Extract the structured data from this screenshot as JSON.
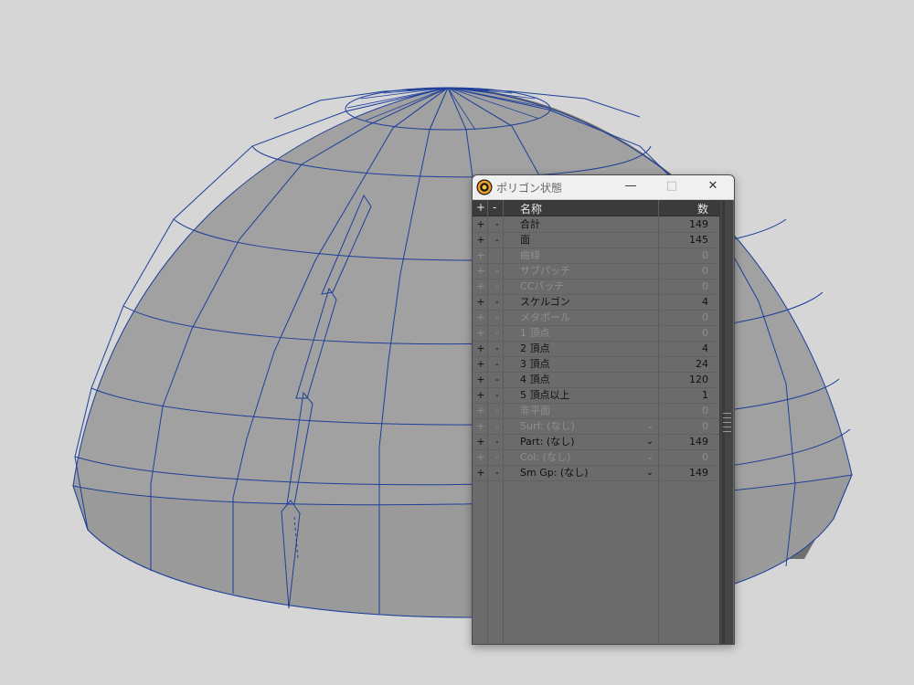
{
  "window": {
    "title": "ポリゴン状態",
    "minimize_glyph": "—",
    "maximize_glyph": "□",
    "close_glyph": "✕",
    "icon": "modo-logo-icon"
  },
  "table": {
    "headers": {
      "plus": "+",
      "minus": "-",
      "name": "名称",
      "count": "数"
    },
    "rows": [
      {
        "plus": "+",
        "minus": "-",
        "name": "合計",
        "count": "149",
        "active": true,
        "dropdown": ""
      },
      {
        "plus": "+",
        "minus": "-",
        "name": "面",
        "count": "145",
        "active": true,
        "dropdown": ""
      },
      {
        "plus": "+",
        "minus": "-",
        "name": "曲線",
        "count": "0",
        "active": false,
        "dropdown": ""
      },
      {
        "plus": "+",
        "minus": "-",
        "name": "サブパッチ",
        "count": "0",
        "active": false,
        "dropdown": ""
      },
      {
        "plus": "+",
        "minus": "-",
        "name": "CCパッチ",
        "count": "0",
        "active": false,
        "dropdown": ""
      },
      {
        "plus": "+",
        "minus": "-",
        "name": "スケルゴン",
        "count": "4",
        "active": true,
        "dropdown": ""
      },
      {
        "plus": "+",
        "minus": "-",
        "name": "メタボール",
        "count": "0",
        "active": false,
        "dropdown": ""
      },
      {
        "plus": "+",
        "minus": "-",
        "name": "1 頂点",
        "count": "0",
        "active": false,
        "dropdown": ""
      },
      {
        "plus": "+",
        "minus": "-",
        "name": "2 頂点",
        "count": "4",
        "active": true,
        "dropdown": ""
      },
      {
        "plus": "+",
        "minus": "-",
        "name": "3 頂点",
        "count": "24",
        "active": true,
        "dropdown": ""
      },
      {
        "plus": "+",
        "minus": "-",
        "name": "4 頂点",
        "count": "120",
        "active": true,
        "dropdown": ""
      },
      {
        "plus": "+",
        "minus": "-",
        "name": "5 頂点以上",
        "count": "1",
        "active": true,
        "dropdown": ""
      },
      {
        "plus": "+",
        "minus": "-",
        "name": "非平面",
        "count": "0",
        "active": false,
        "dropdown": ""
      },
      {
        "plus": "+",
        "minus": "-",
        "name": "Surf: (なし)",
        "count": "0",
        "active": false,
        "dropdown": "⌄"
      },
      {
        "plus": "+",
        "minus": "-",
        "name": "Part: (なし)",
        "count": "149",
        "active": true,
        "dropdown": "⌄"
      },
      {
        "plus": "+",
        "minus": "-",
        "name": "Col: (なし)",
        "count": "0",
        "active": false,
        "dropdown": "⌄"
      },
      {
        "plus": "+",
        "minus": "-",
        "name": "Sm Gp: (なし)",
        "count": "149",
        "active": true,
        "dropdown": "⌄"
      }
    ]
  },
  "colors": {
    "background": "#d6d6d6",
    "mesh_fill": "#999999",
    "mesh_wire": "#1f3f9a",
    "panel_bg": "#6b6b6b",
    "header_bg": "#3b3b3b"
  }
}
